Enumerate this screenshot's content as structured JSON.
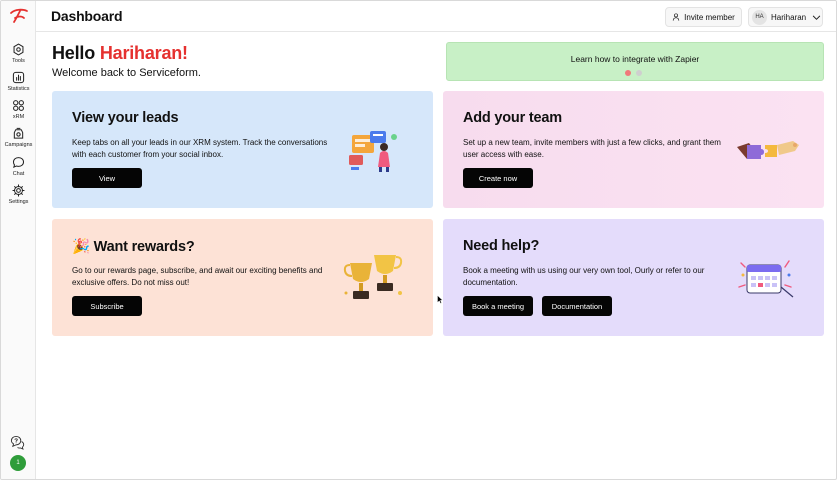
{
  "header": {
    "title": "Dashboard",
    "invite_label": "Invite member",
    "user_initials": "HA",
    "user_name": "Hariharan"
  },
  "sidebar": {
    "items": [
      {
        "label": "Tools",
        "icon": "tools-icon"
      },
      {
        "label": "Statistics",
        "icon": "statistics-icon"
      },
      {
        "label": "xRM",
        "icon": "xrm-icon"
      },
      {
        "label": "Campaigns",
        "icon": "campaigns-icon"
      },
      {
        "label": "Chat",
        "icon": "chat-icon"
      },
      {
        "label": "Settings",
        "icon": "settings-icon"
      }
    ],
    "status_badge": "1"
  },
  "greeting": {
    "hello": "Hello",
    "name": "Hariharan!",
    "welcome": "Welcome back to Serviceform."
  },
  "banner": {
    "text": "Learn how to integrate with Zapier"
  },
  "cards": {
    "leads": {
      "title": "View your leads",
      "description": "Keep tabs on all your leads in our XRM system. Track the conversations with each customer from your social inbox.",
      "button": "View"
    },
    "team": {
      "title": "Add your team",
      "description": "Set up a new team, invite members with just a few clicks, and grant them user access with ease.",
      "button": "Create now"
    },
    "rewards": {
      "title": "🎉 Want rewards?",
      "description": "Go to our rewards page, subscribe, and await our exciting benefits and exclusive offers. Do not miss out!",
      "button": "Subscribe"
    },
    "help": {
      "title": "Need help?",
      "description": "Book a meeting with us using our very own tool, Ourly or refer to our documentation.",
      "button_primary": "Book a meeting",
      "button_secondary": "Documentation"
    }
  },
  "colors": {
    "accent_red": "#e5312f",
    "leads_bg": "#d6e7fa",
    "team_bg": "#f9dff0",
    "rewards_bg": "#fde2d6",
    "help_bg": "#e4dcfb",
    "banner_bg": "#c8f0c6",
    "status_green": "#2f9d3a"
  }
}
